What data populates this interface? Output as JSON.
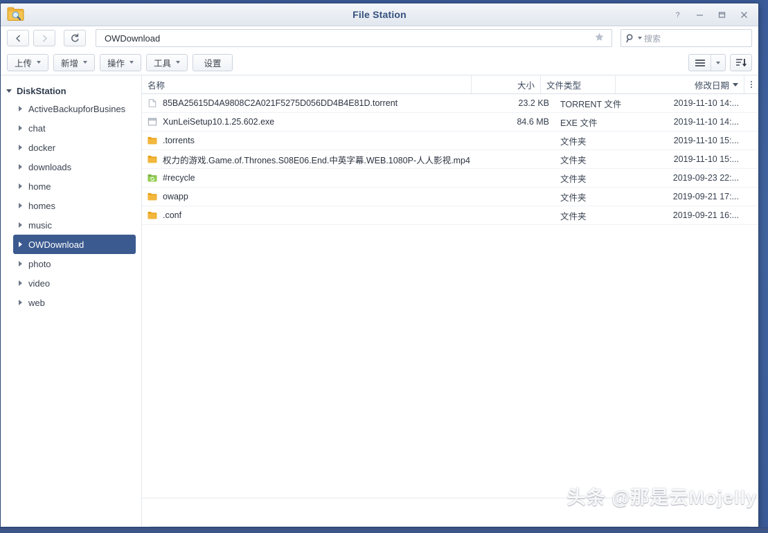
{
  "window": {
    "title": "File Station",
    "app_icon": "folder-search-icon",
    "controls": [
      {
        "name": "help-button",
        "glyph": "?"
      },
      {
        "name": "minimize-button",
        "glyph": "–"
      },
      {
        "name": "maximize-button",
        "glyph": "□"
      },
      {
        "name": "close-button",
        "glyph": "✕"
      }
    ]
  },
  "addressbar": {
    "back_icon": "chevron-left-icon",
    "forward_icon": "chevron-right-icon",
    "refresh_icon": "refresh-icon",
    "path": "OWDownload",
    "favorite_icon": "star-icon",
    "search_icon": "search-icon",
    "search_placeholder": "搜索",
    "search_value": ""
  },
  "toolbar": {
    "buttons": [
      {
        "label": "上传",
        "name": "upload-button",
        "dropdown": true
      },
      {
        "label": "新增",
        "name": "create-button",
        "dropdown": true
      },
      {
        "label": "操作",
        "name": "action-button",
        "dropdown": true
      },
      {
        "label": "工具",
        "name": "tools-button",
        "dropdown": true
      },
      {
        "label": "设置",
        "name": "settings-button",
        "dropdown": false
      }
    ],
    "view_mode_icon": "list-view-icon",
    "view_mode_caret_icon": "chevron-down-icon",
    "sort_icon": "sort-descending-icon"
  },
  "sidebar": {
    "root": {
      "label": "DiskStation",
      "name": "sidebar-root-diskstation",
      "expanded": true
    },
    "items": [
      {
        "label": "ActiveBackupforBusines",
        "name": "sidebar-item-activebackupforbusiness",
        "selected": false
      },
      {
        "label": "chat",
        "name": "sidebar-item-chat",
        "selected": false
      },
      {
        "label": "docker",
        "name": "sidebar-item-docker",
        "selected": false
      },
      {
        "label": "downloads",
        "name": "sidebar-item-downloads",
        "selected": false
      },
      {
        "label": "home",
        "name": "sidebar-item-home",
        "selected": false
      },
      {
        "label": "homes",
        "name": "sidebar-item-homes",
        "selected": false
      },
      {
        "label": "music",
        "name": "sidebar-item-music",
        "selected": false
      },
      {
        "label": "OWDownload",
        "name": "sidebar-item-owdownload",
        "selected": true
      },
      {
        "label": "photo",
        "name": "sidebar-item-photo",
        "selected": false
      },
      {
        "label": "video",
        "name": "sidebar-item-video",
        "selected": false
      },
      {
        "label": "web",
        "name": "sidebar-item-web",
        "selected": false
      }
    ]
  },
  "filelist": {
    "columns": {
      "name": "名称",
      "size": "大小",
      "type": "文件类型",
      "date": "修改日期"
    },
    "sort_column": "修改日期",
    "sort_caret_icon": "chevron-down-icon",
    "column_menu_icon": "more-vertical-icon",
    "rows": [
      {
        "name": "85BA25615D4A9808C2A021F5275D056DD4B4E81D.torrent",
        "size": "23.2 KB",
        "type": "TORRENT 文件",
        "date": "2019-11-10 14:...",
        "icon": "file-icon"
      },
      {
        "name": "XunLeiSetup10.1.25.602.exe",
        "size": "84.6 MB",
        "type": "EXE 文件",
        "date": "2019-11-10 14:...",
        "icon": "exe-file-icon"
      },
      {
        "name": ".torrents",
        "size": "",
        "type": "文件夹",
        "date": "2019-11-10 15:...",
        "icon": "folder-icon"
      },
      {
        "name": "权力的游戏.Game.of.Thrones.S08E06.End.中英字幕.WEB.1080P-人人影视.mp4",
        "size": "",
        "type": "文件夹",
        "date": "2019-11-10 15:...",
        "icon": "folder-icon"
      },
      {
        "name": "#recycle",
        "size": "",
        "type": "文件夹",
        "date": "2019-09-23 22:...",
        "icon": "recycle-folder-icon"
      },
      {
        "name": "owapp",
        "size": "",
        "type": "文件夹",
        "date": "2019-09-21 17:...",
        "icon": "folder-icon"
      },
      {
        "name": ".conf",
        "size": "",
        "type": "文件夹",
        "date": "2019-09-21 16:...",
        "icon": "folder-icon"
      }
    ]
  },
  "statusbar": {
    "text": ""
  },
  "watermark": {
    "text": "头条 @那是云Mojelly"
  },
  "colors": {
    "selection": "#3b5a8f",
    "title_text": "#34507e",
    "desktop": "#3c5d9a",
    "folder": "#f0b429",
    "recycle": "#7cc04a"
  }
}
